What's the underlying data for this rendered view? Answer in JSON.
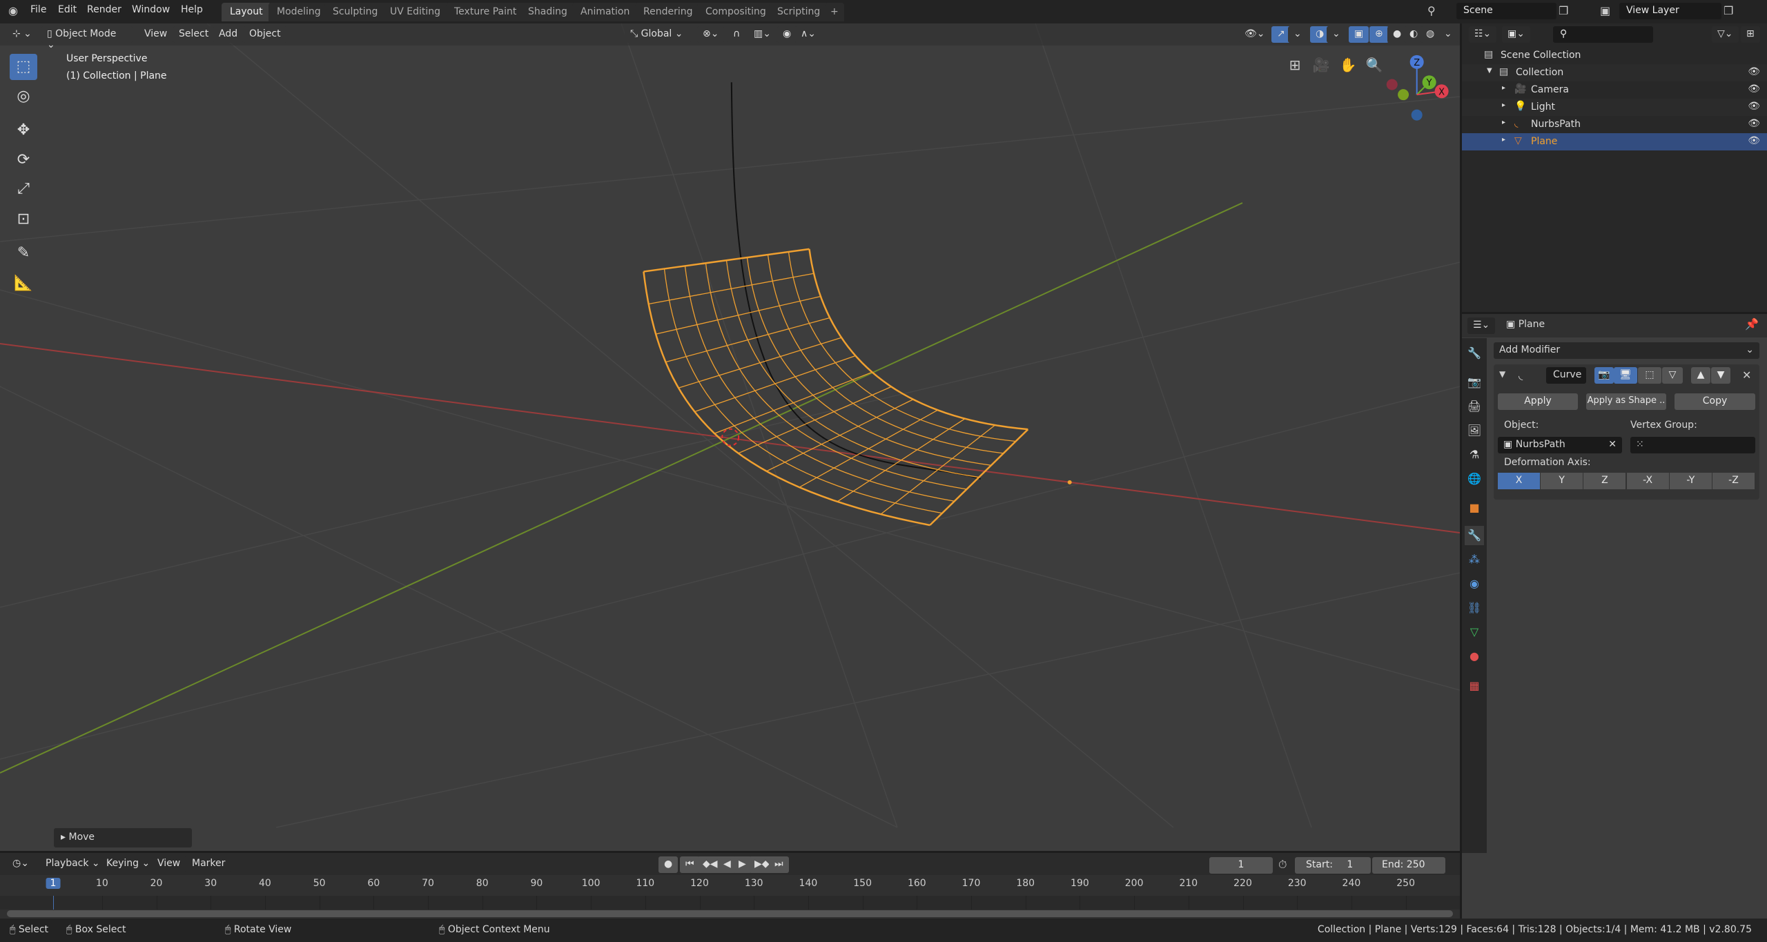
{
  "topbar": {
    "menus": [
      "File",
      "Edit",
      "Render",
      "Window",
      "Help"
    ],
    "tabs": [
      "Layout",
      "Modeling",
      "Sculpting",
      "UV Editing",
      "Texture Paint",
      "Shading",
      "Animation",
      "Rendering",
      "Compositing",
      "Scripting"
    ],
    "active_tab": "Layout",
    "add_tab": "+",
    "scene": "Scene",
    "view_layer": "View Layer"
  },
  "viewport": {
    "mode": "Object Mode",
    "menus": [
      "View",
      "Select",
      "Add",
      "Object"
    ],
    "orientation": "Global",
    "overlay_title": "User Perspective",
    "overlay_sub": "(1) Collection | Plane",
    "last_op": "Move",
    "gizmo": {
      "x": "X",
      "y": "Y",
      "z": "Z"
    },
    "colors": {
      "bg": "#3d3d3d",
      "selected": "#f0a030",
      "x_axis": "#9a3b3b",
      "y_axis": "#6b8a2a"
    }
  },
  "outliner": {
    "search_placeholder": "",
    "items": [
      {
        "label": "Scene Collection",
        "depth": 0
      },
      {
        "label": "Collection",
        "depth": 1
      },
      {
        "label": "Camera",
        "depth": 2
      },
      {
        "label": "Light",
        "depth": 2
      },
      {
        "label": "NurbsPath",
        "depth": 2
      },
      {
        "label": "Plane",
        "depth": 2,
        "selected": true
      }
    ]
  },
  "properties": {
    "object": "Plane",
    "add_modifier": "Add Modifier",
    "modifier": {
      "name": "Curve",
      "apply": "Apply",
      "apply_shape": "Apply as Shape ..",
      "copy": "Copy",
      "object_label": "Object:",
      "object_value": "NurbsPath",
      "vgroup_label": "Vertex Group:",
      "vgroup_value": "",
      "axis_label": "Deformation Axis:",
      "axes": [
        "X",
        "Y",
        "Z",
        "-X",
        "-Y",
        "-Z"
      ],
      "active_axis": "X"
    }
  },
  "timeline": {
    "menus": [
      "Playback",
      "Keying",
      "View",
      "Marker"
    ],
    "current": "1",
    "start_label": "Start:",
    "start": "1",
    "end_label": "End:",
    "end": "250",
    "ticks": [
      "1",
      "10",
      "20",
      "30",
      "40",
      "50",
      "60",
      "70",
      "80",
      "90",
      "100",
      "110",
      "120",
      "130",
      "140",
      "150",
      "160",
      "170",
      "180",
      "190",
      "200",
      "210",
      "220",
      "230",
      "240",
      "250"
    ]
  },
  "status": {
    "select": "Select",
    "box_select": "Box Select",
    "rotate": "Rotate View",
    "context": "Object Context Menu",
    "info": "Collection | Plane | Verts:129 | Faces:64 | Tris:128 | Objects:1/4 | Mem: 41.2 MB | v2.80.75"
  }
}
